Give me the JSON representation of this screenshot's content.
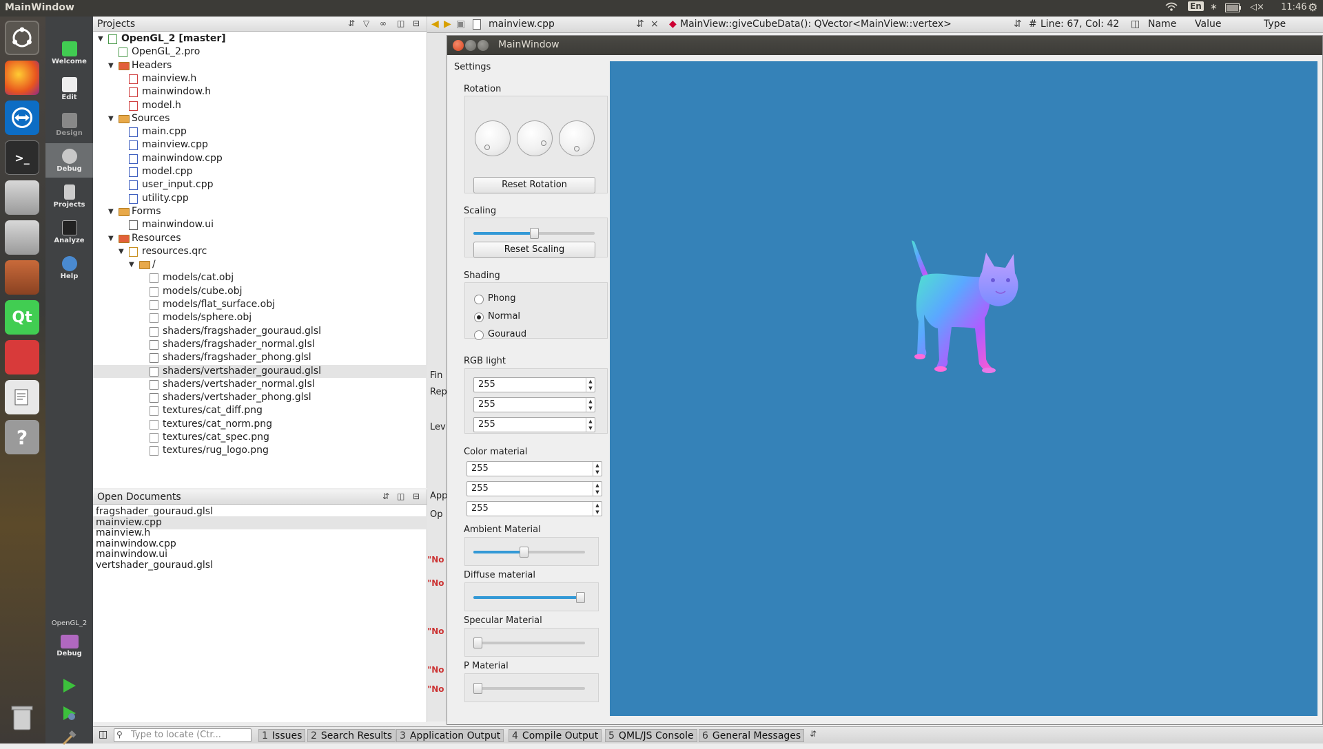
{
  "top_panel": {
    "title": "MainWindow",
    "kb": "En",
    "clock": "11:46"
  },
  "launcher": {
    "items": [
      "ubuntu-dash-icon",
      "firefox-icon",
      "teamviewer-icon",
      "terminal-icon",
      "drive-icon",
      "drive2-icon",
      "files-icon",
      "qt-creator-icon",
      "text-app-icon",
      "editor-icon",
      "help-icon",
      "trash-icon"
    ]
  },
  "mode_bar": {
    "modes": [
      "Welcome",
      "Edit",
      "Design",
      "Debug",
      "Projects",
      "Analyze",
      "Help"
    ],
    "active": "Debug",
    "project_label": "OpenGL_2",
    "target_label": "Debug"
  },
  "projects_pane": {
    "header": "Projects",
    "tree": [
      {
        "label": "OpenGL_2 [master]",
        "depth": 0,
        "bold": true,
        "expanded": true,
        "kind": "project"
      },
      {
        "label": "OpenGL_2.pro",
        "depth": 1,
        "kind": "pro"
      },
      {
        "label": "Headers",
        "depth": 1,
        "expanded": true,
        "kind": "folder-h"
      },
      {
        "label": "mainview.h",
        "depth": 2,
        "kind": "h"
      },
      {
        "label": "mainwindow.h",
        "depth": 2,
        "kind": "h"
      },
      {
        "label": "model.h",
        "depth": 2,
        "kind": "h"
      },
      {
        "label": "Sources",
        "depth": 1,
        "expanded": true,
        "kind": "folder-src"
      },
      {
        "label": "main.cpp",
        "depth": 2,
        "kind": "cpp"
      },
      {
        "label": "mainview.cpp",
        "depth": 2,
        "kind": "cpp"
      },
      {
        "label": "mainwindow.cpp",
        "depth": 2,
        "kind": "cpp"
      },
      {
        "label": "model.cpp",
        "depth": 2,
        "kind": "cpp"
      },
      {
        "label": "user_input.cpp",
        "depth": 2,
        "kind": "cpp"
      },
      {
        "label": "utility.cpp",
        "depth": 2,
        "kind": "cpp"
      },
      {
        "label": "Forms",
        "depth": 1,
        "expanded": true,
        "kind": "folder-form"
      },
      {
        "label": "mainwindow.ui",
        "depth": 2,
        "kind": "ui"
      },
      {
        "label": "Resources",
        "depth": 1,
        "expanded": true,
        "kind": "folder-res"
      },
      {
        "label": "resources.qrc",
        "depth": 2,
        "expanded": true,
        "kind": "qrc"
      },
      {
        "label": "/",
        "depth": 3,
        "expanded": true,
        "kind": "folder"
      },
      {
        "label": "models/cat.obj",
        "depth": 4,
        "kind": "file"
      },
      {
        "label": "models/cube.obj",
        "depth": 4,
        "kind": "file"
      },
      {
        "label": "models/flat_surface.obj",
        "depth": 4,
        "kind": "file"
      },
      {
        "label": "models/sphere.obj",
        "depth": 4,
        "kind": "file"
      },
      {
        "label": "shaders/fragshader_gouraud.glsl",
        "depth": 4,
        "kind": "glsl"
      },
      {
        "label": "shaders/fragshader_normal.glsl",
        "depth": 4,
        "kind": "glsl"
      },
      {
        "label": "shaders/fragshader_phong.glsl",
        "depth": 4,
        "kind": "glsl"
      },
      {
        "label": "shaders/vertshader_gouraud.glsl",
        "depth": 4,
        "kind": "glsl",
        "selected": true
      },
      {
        "label": "shaders/vertshader_normal.glsl",
        "depth": 4,
        "kind": "glsl"
      },
      {
        "label": "shaders/vertshader_phong.glsl",
        "depth": 4,
        "kind": "glsl"
      },
      {
        "label": "textures/cat_diff.png",
        "depth": 4,
        "kind": "file"
      },
      {
        "label": "textures/cat_norm.png",
        "depth": 4,
        "kind": "file"
      },
      {
        "label": "textures/cat_spec.png",
        "depth": 4,
        "kind": "file"
      },
      {
        "label": "textures/rug_logo.png",
        "depth": 4,
        "kind": "file"
      }
    ]
  },
  "open_documents": {
    "header": "Open Documents",
    "items": [
      {
        "label": "fragshader_gouraud.glsl"
      },
      {
        "label": "mainview.cpp",
        "selected": true
      },
      {
        "label": "mainview.h"
      },
      {
        "label": "mainwindow.cpp"
      },
      {
        "label": "mainwindow.ui"
      },
      {
        "label": "vertshader_gouraud.glsl"
      }
    ]
  },
  "editor_bar": {
    "file": "mainview.cpp",
    "symbol": "MainView::giveCubeData(): QVector<MainView::vertex>",
    "position": "Line: 67, Col: 42",
    "cols": [
      "Name",
      "Value",
      "Type"
    ]
  },
  "behind_fragments": {
    "find": "Fin",
    "rep": "Rep",
    "lev": "Lev",
    "app": "App",
    "op": "Op",
    "no": "\"No"
  },
  "status_bar": {
    "locate_placeholder": "Type to locate (Ctr...",
    "buttons": [
      {
        "num": "1",
        "label": "Issues"
      },
      {
        "num": "2",
        "label": "Search Results"
      },
      {
        "num": "3",
        "label": "Application Output"
      },
      {
        "num": "4",
        "label": "Compile Output"
      },
      {
        "num": "5",
        "label": "QML/JS Console"
      },
      {
        "num": "6",
        "label": "General Messages"
      }
    ]
  },
  "main_window": {
    "title": "MainWindow",
    "settings_label": "Settings",
    "rotation": {
      "label": "Rotation",
      "reset": "Reset Rotation"
    },
    "scaling": {
      "label": "Scaling",
      "reset": "Reset Scaling",
      "value": 0.5
    },
    "shading": {
      "label": "Shading",
      "options": [
        "Phong",
        "Normal",
        "Gouraud"
      ],
      "selected": "Normal"
    },
    "rgb_light": {
      "label": "RGB light",
      "values": [
        "255",
        "255",
        "255"
      ]
    },
    "color_material": {
      "label": "Color material",
      "values": [
        "255",
        "255",
        "255"
      ]
    },
    "ambient": {
      "label": "Ambient Material",
      "value": 0.45
    },
    "diffuse": {
      "label": "Diffuse material",
      "value": 1.0
    },
    "specular": {
      "label": "Specular Material",
      "value": 0.0
    },
    "p_material": {
      "label": "P Material",
      "value": 0.0
    }
  },
  "colors": {
    "viewport": "#3582b8",
    "slider_fill": "#3399d6",
    "ubuntu_panel": "#3c3b37"
  }
}
